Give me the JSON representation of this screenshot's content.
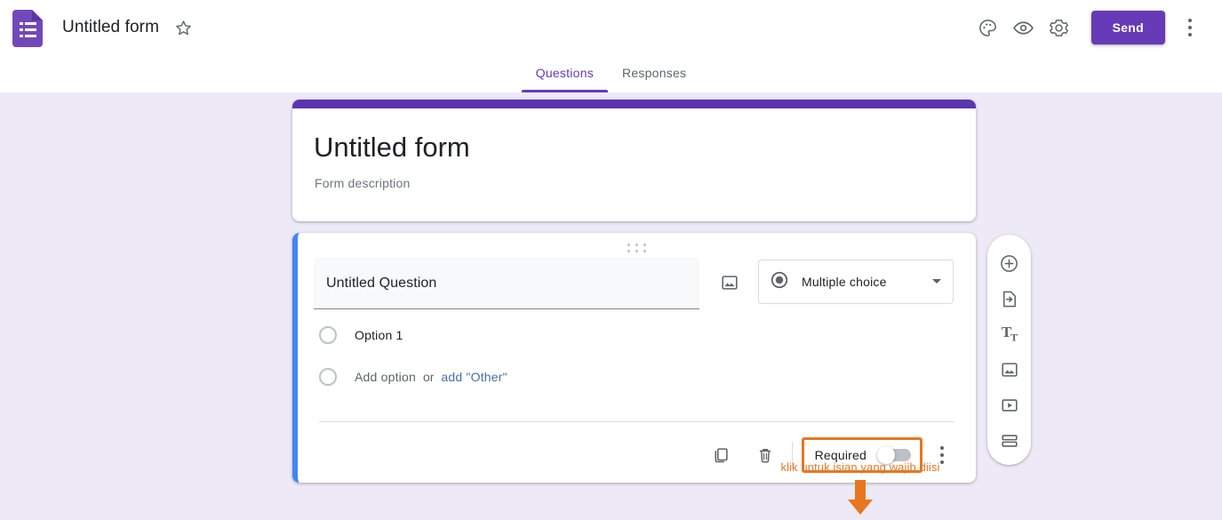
{
  "app": {
    "name": "Google Forms",
    "logo_icon": "google-forms-logo-icon",
    "document_title": "Untitled form",
    "star_icon": "star-outline-icon"
  },
  "toolbar": {
    "theme_icon": "palette-icon",
    "preview_icon": "eye-preview-icon",
    "settings_icon": "gear-settings-icon",
    "send_label": "Send",
    "more_icon": "kebab-more-icon"
  },
  "tabs": [
    {
      "label": "Questions",
      "active": true
    },
    {
      "label": "Responses",
      "active": false
    }
  ],
  "form_header": {
    "title": "Untitled form",
    "description": "Form description",
    "band_color": "#5c35b0"
  },
  "question": {
    "drag_handle_icon": "drag-handle-dots-icon",
    "title": "Untitled Question",
    "image_icon": "add-image-icon",
    "type": {
      "icon": "radio-filled-icon",
      "label": "Multiple choice",
      "chevron_icon": "chevron-down-icon"
    },
    "options": [
      {
        "label": "Option 1",
        "radio_icon": "radio-empty-icon"
      }
    ],
    "add_option": {
      "radio_icon": "radio-empty-icon",
      "label": "Add option",
      "or_label": "or",
      "other_label": "add \"Other\""
    },
    "footer": {
      "duplicate_icon": "duplicate-copy-icon",
      "delete_icon": "trash-delete-icon",
      "required_label": "Required",
      "required_on": false,
      "more_icon": "kebab-more-icon"
    }
  },
  "annotation": {
    "text": "klik untuk isian yang wajib diisi",
    "arrow_icon": "down-arrow-icon",
    "color": "#e8761f"
  },
  "side_toolbar": [
    {
      "icon": "add-question-plus-circle-icon",
      "name": "add-question"
    },
    {
      "icon": "import-questions-icon",
      "name": "import-questions"
    },
    {
      "icon": "add-title-description-tt-icon",
      "name": "add-title-and-description"
    },
    {
      "icon": "add-image-icon",
      "name": "add-image"
    },
    {
      "icon": "add-video-play-icon",
      "name": "add-video"
    },
    {
      "icon": "add-section-icon",
      "name": "add-section"
    }
  ],
  "colors": {
    "brand_purple": "#673ab7",
    "accent_blue": "#4285f4",
    "annotation_orange": "#e8761f",
    "page_background": "#ede9f6"
  }
}
